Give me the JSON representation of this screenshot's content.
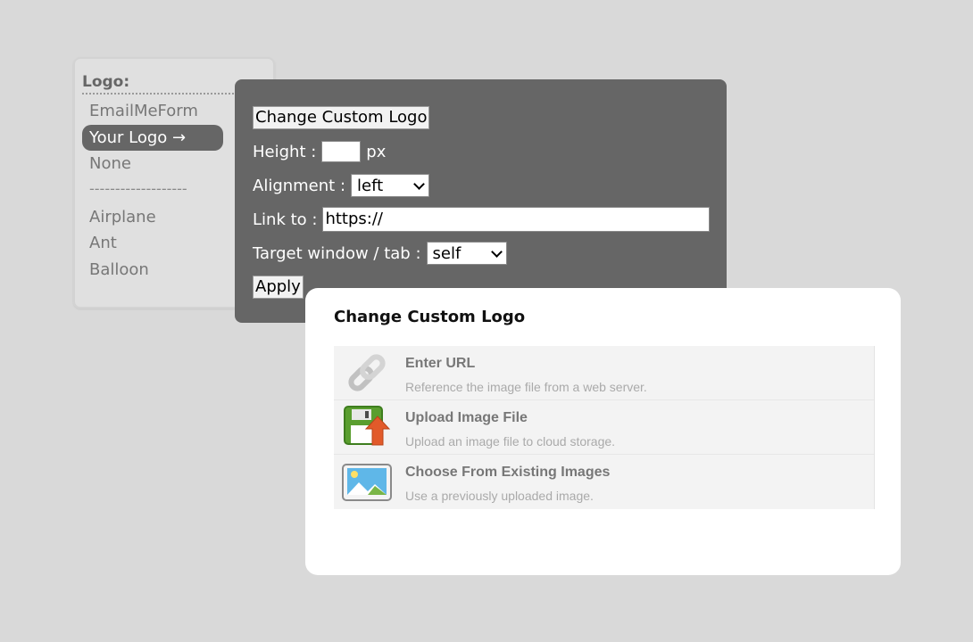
{
  "logo_panel": {
    "title": "Logo:",
    "items": [
      {
        "label": "EmailMeForm",
        "selected": false
      },
      {
        "label": "Your Logo →",
        "selected": true
      },
      {
        "label": "None",
        "selected": false
      }
    ],
    "divider": "-------------------",
    "presets": [
      "Airplane",
      "Ant",
      "Balloon"
    ]
  },
  "settings": {
    "change_logo_label": "Change Custom Logo",
    "height_label": "Height :",
    "height_value": "",
    "height_unit": "px",
    "alignment_label": "Alignment :",
    "alignment_value": "left",
    "link_label": "Link to :",
    "link_value": "https://",
    "target_label": "Target window / tab :",
    "target_value": "self",
    "apply_label": "Apply"
  },
  "modal": {
    "title": "Change Custom Logo",
    "options": [
      {
        "name": "Enter URL",
        "description": "Reference the image file from a web server.",
        "icon": "link-icon"
      },
      {
        "name": "Upload Image File",
        "description": "Upload an image file to cloud storage.",
        "icon": "upload-file-icon"
      },
      {
        "name": "Choose From Existing Images",
        "description": "Use a previously uploaded image.",
        "icon": "image-gallery-icon"
      }
    ]
  }
}
